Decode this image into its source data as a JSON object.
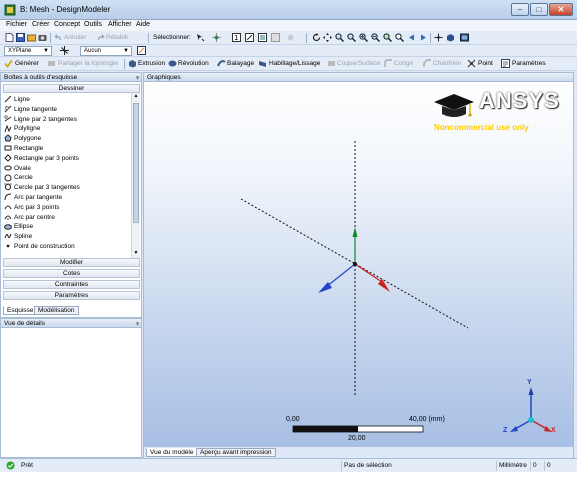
{
  "window": {
    "title": "B: Mesh - DesignModeler",
    "minimize": "–",
    "maximize": "□",
    "close": "✕"
  },
  "menu": [
    "Fichier",
    "Créer",
    "Concept",
    "Outils",
    "Afficher",
    "Aide"
  ],
  "toolbar1": {
    "undo": "Annuler",
    "redo": "Rétablir",
    "select_label": "Sélectionner:"
  },
  "toolbar2": {
    "plane": "XYPlane",
    "sketch": "Aucun"
  },
  "toolbar3": {
    "generate": "Générer",
    "share_topology": "Partager la topologie",
    "extrude": "Extrusion",
    "revolve": "Révolution",
    "sweep": "Balayage",
    "skin_loft": "Habillage/Lissage",
    "surface": "Coque/Surface",
    "fixed_blend": "Congé",
    "chamfer": "Chanfrein",
    "point": "Point",
    "parameters": "Paramètres"
  },
  "sketch_panel": {
    "title": "Boîtes à outils d'esquisse",
    "pin": "ᵩ",
    "draw_section": "Dessiner",
    "tools": [
      {
        "label": "Ligne",
        "icon": "line-icon"
      },
      {
        "label": "Ligne tangente",
        "icon": "tangent-line-icon"
      },
      {
        "label": "Ligne par 2 tangentes",
        "icon": "line-2-tangents-icon"
      },
      {
        "label": "Polyligne",
        "icon": "polyline-icon"
      },
      {
        "label": "Polygone",
        "icon": "polygon-icon"
      },
      {
        "label": "Rectangle",
        "icon": "rectangle-icon"
      },
      {
        "label": "Rectangle par 3 points",
        "icon": "rectangle-3-points-icon"
      },
      {
        "label": "Ovale",
        "icon": "oval-icon"
      },
      {
        "label": "Cercle",
        "icon": "circle-icon"
      },
      {
        "label": "Cercle par 3 tangentes",
        "icon": "circle-3-tangents-icon"
      },
      {
        "label": "Arc par tangente",
        "icon": "arc-tangent-icon"
      },
      {
        "label": "Arc par 3 points",
        "icon": "arc-3-points-icon"
      },
      {
        "label": "Arc par centre",
        "icon": "arc-center-icon"
      },
      {
        "label": "Ellipse",
        "icon": "ellipse-icon"
      },
      {
        "label": "Spline",
        "icon": "spline-icon"
      },
      {
        "label": "Point de construction",
        "icon": "construction-point-icon"
      }
    ],
    "modify_section": "Modifier",
    "dimensions_section": "Cotes",
    "constraints_section": "Contraintes",
    "settings_section": "Paramètres",
    "tabs": [
      "Esquisse",
      "Modélisation"
    ]
  },
  "details_panel": {
    "title": "Vue de détails",
    "pin": "ᵩ"
  },
  "graphics": {
    "title": "Graphiques",
    "logo_text": "ANSYS",
    "logo_subtitle": "Noncommercial use only",
    "scale": {
      "start": "0,00",
      "end": "40,00 (mm)",
      "mid": "20,00"
    },
    "triad": {
      "x": "X",
      "y": "Y",
      "z": "Z"
    },
    "tabs": [
      "Vue du modèle",
      "Aperçu avant impression"
    ]
  },
  "status": {
    "ready": "Prêt",
    "selection": "Pas de sélection",
    "units": "Millimètre",
    "val1": "0",
    "val2": "0"
  }
}
